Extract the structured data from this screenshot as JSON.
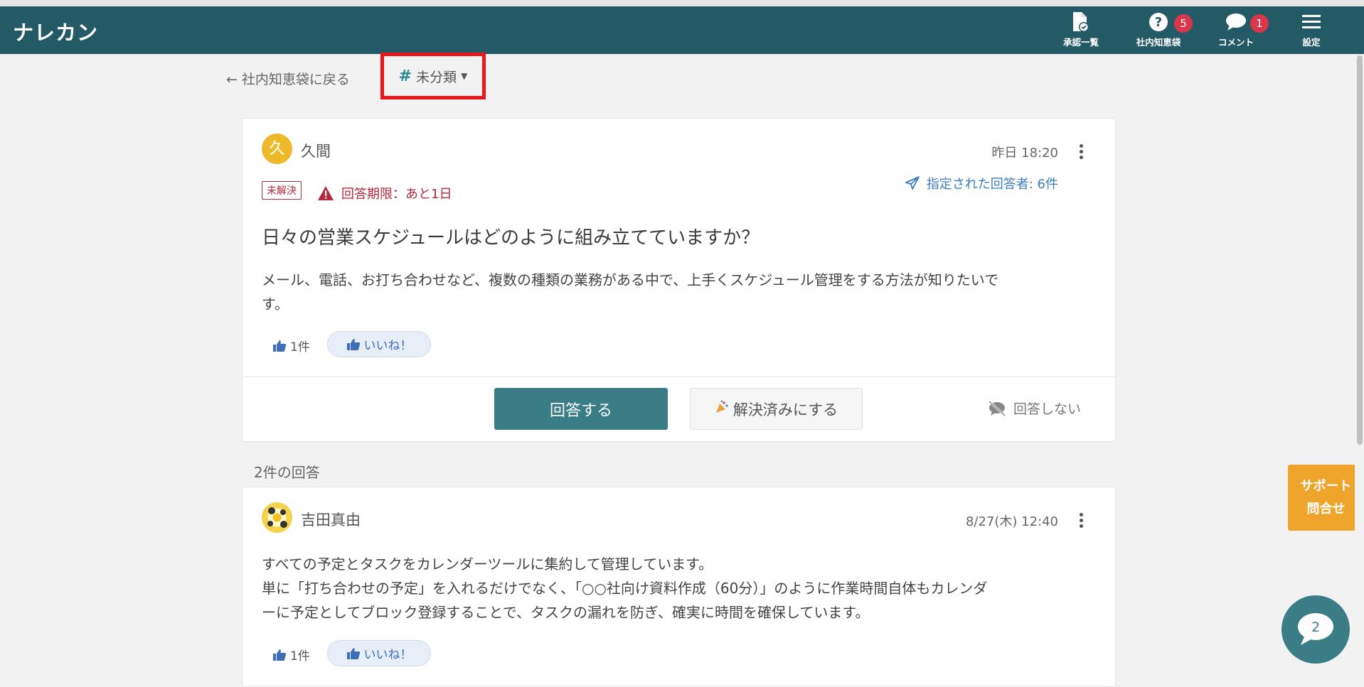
{
  "app": {
    "logo": "ナレカン"
  },
  "nav": [
    {
      "label": "承認一覧",
      "icon": "document-check-icon",
      "badge": null
    },
    {
      "label": "社内知恵袋",
      "icon": "question-circle-icon",
      "badge": "5"
    },
    {
      "label": "コメント",
      "icon": "comment-bubble-icon",
      "badge": "1"
    },
    {
      "label": "設定",
      "icon": "hamburger-menu-icon",
      "badge": null
    }
  ],
  "topbar": {
    "back_label": "社内知恵袋に戻る",
    "category_label": "未分類"
  },
  "question": {
    "avatar_initial": "久",
    "author": "久間",
    "time": "昨日 18:20",
    "status": "未解決",
    "deadline": "回答期限：あと1日",
    "assigned": "指定された回答者: 6件",
    "title": "日々の営業スケジュールはどのように組み立てていますか？",
    "body_line1": "メール、電話、お打ち合わせなど、複数の種類の業務がある中で、上手くスケジュール管理をする方法が知りたいで",
    "body_line2": "す。",
    "like_count": "1件",
    "like_button": "いいね！"
  },
  "actions": {
    "answer": "回答する",
    "resolve": "解決済みにする",
    "no_answer": "回答しない"
  },
  "answers_heading": "2件の回答",
  "answer": {
    "author": "吉田真由",
    "time": "8/27(木) 12:40",
    "line1": "すべての予定とタスクをカレンダーツールに集約して管理しています。",
    "line2": "単に「打ち合わせの予定」を入れるだけでなく、「○○社向け資料作成（60分）」のように作業時間自体もカレンダ",
    "line3": "ーに予定としてブロック登録することで、タスクの漏れを防ぎ、確実に時間を確保しています。",
    "like_count": "1件",
    "like_button": "いいね！"
  },
  "support": {
    "line1": "サポート",
    "line2": "問合せ"
  },
  "chat": {
    "badge": "2"
  },
  "colors": {
    "header": "#245a66",
    "accent": "#3a7d87",
    "alert": "#b5283e",
    "support": "#efa52c"
  }
}
